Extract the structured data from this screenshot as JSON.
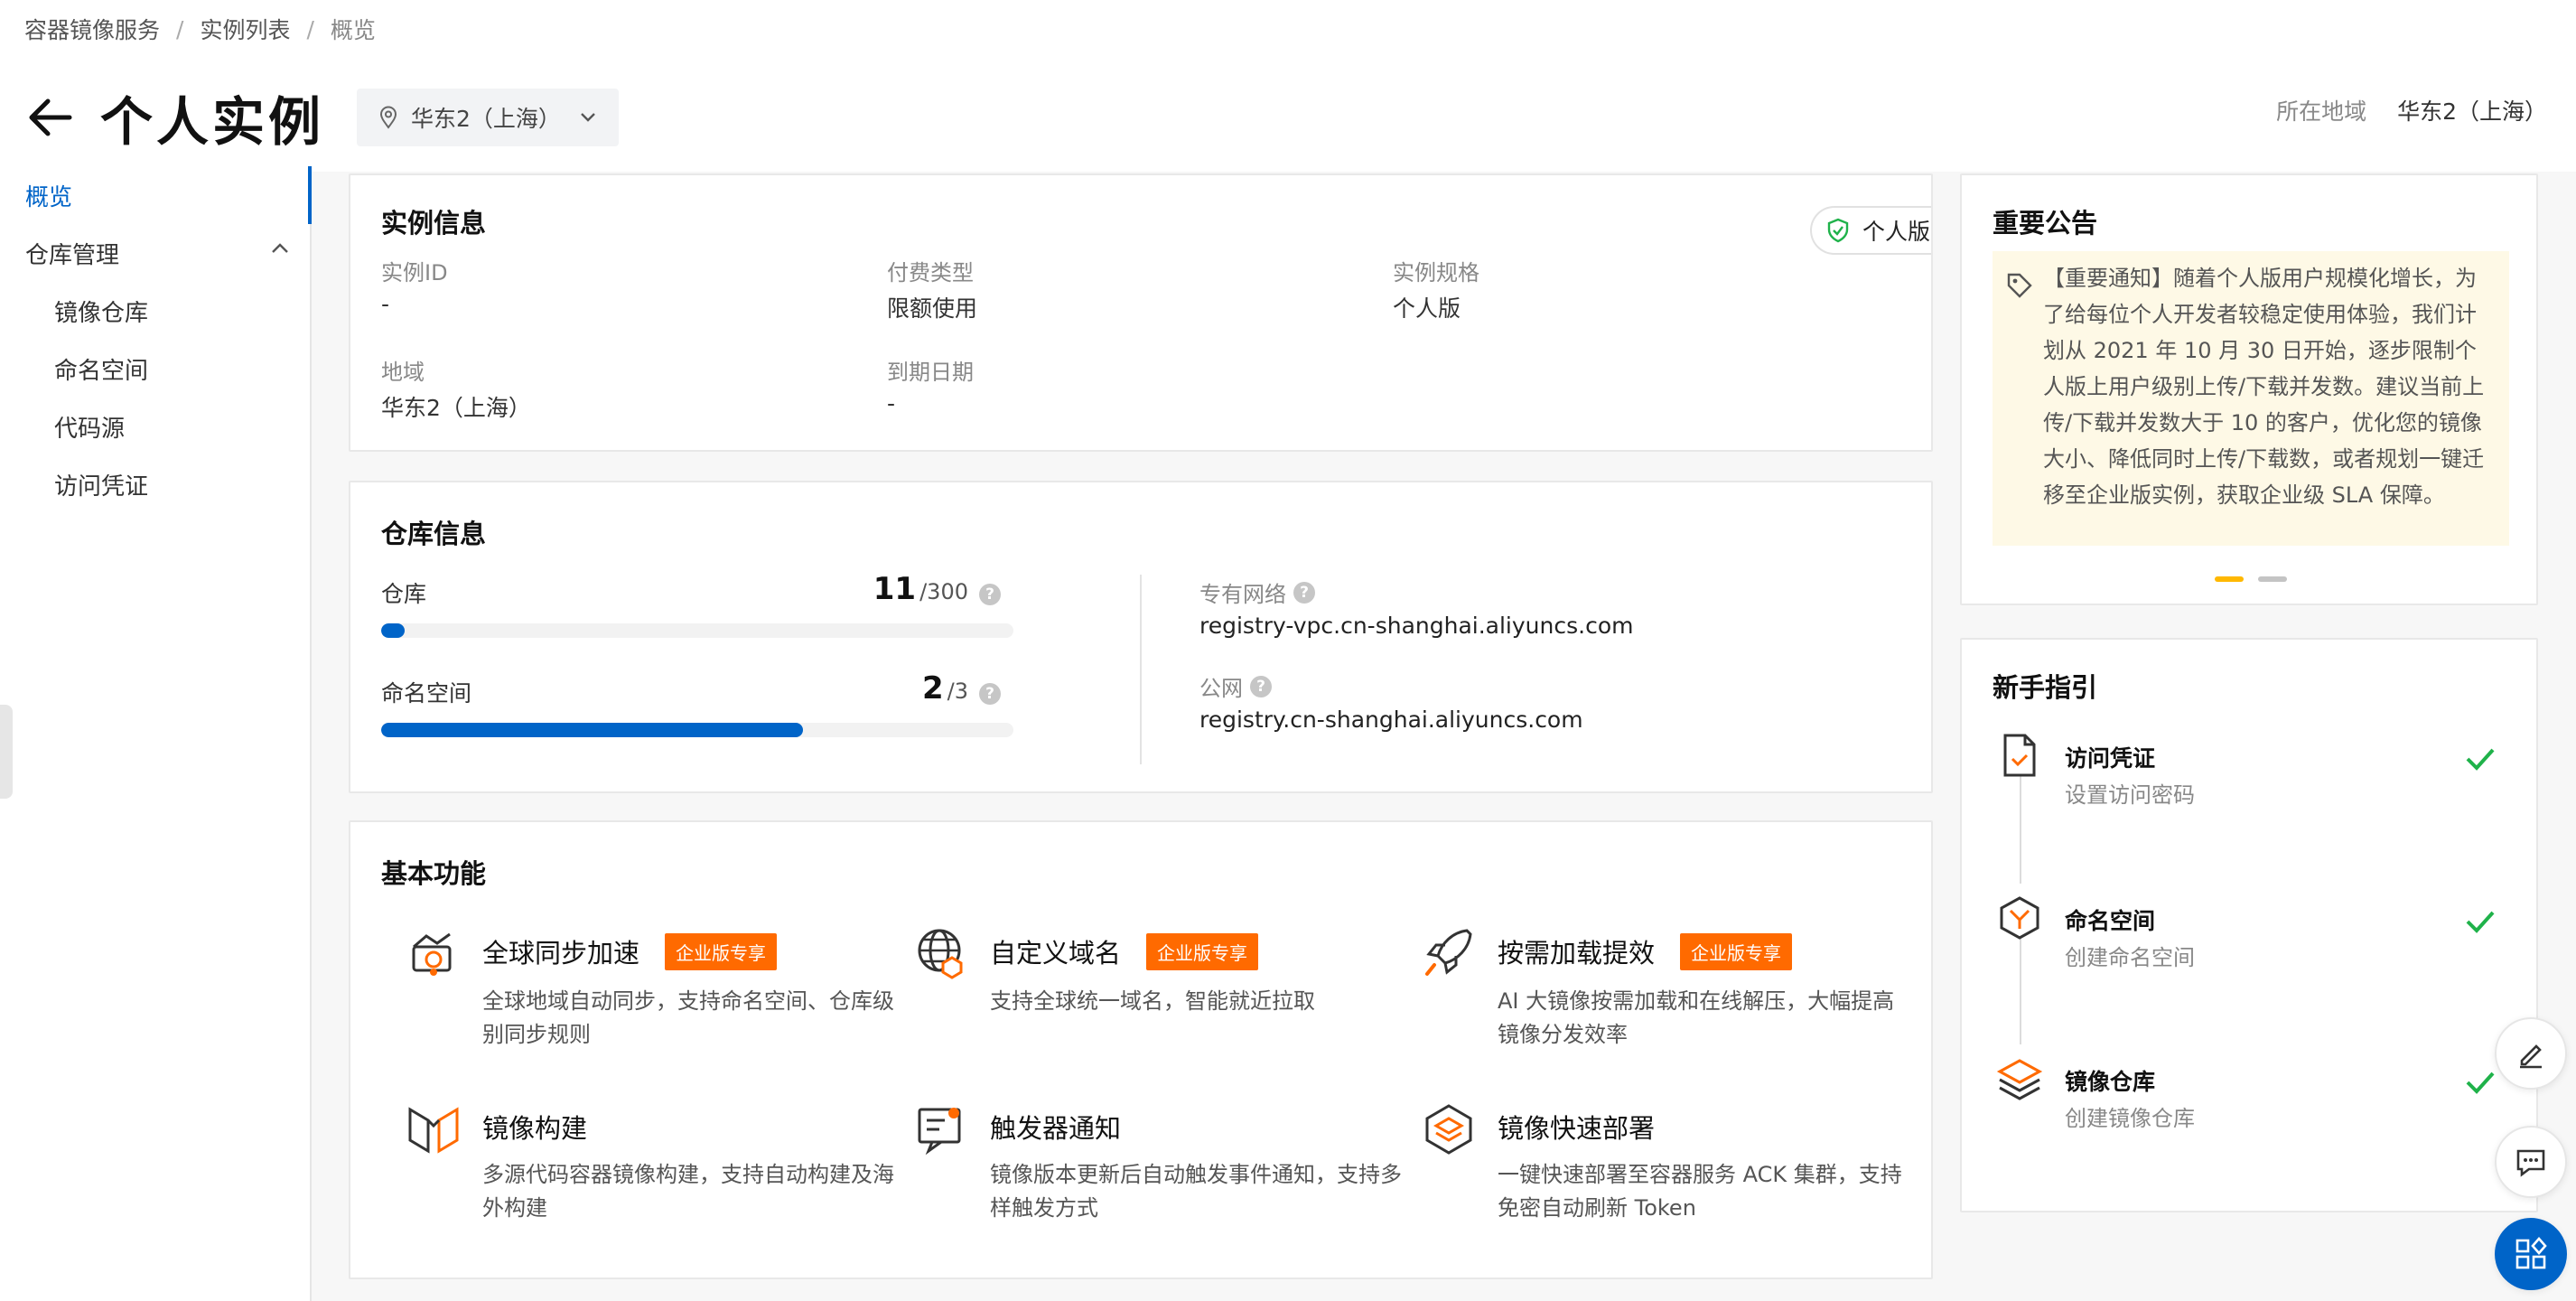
{
  "breadcrumb": [
    "容器镜像服务",
    "实例列表",
    "概览"
  ],
  "header": {
    "title": "个人实例",
    "region_select": "华东2（上海）",
    "region_label": "所在地域",
    "region_value": "华东2（上海）"
  },
  "sidebar": {
    "items": [
      {
        "label": "概览",
        "active": true
      },
      {
        "label": "仓库管理"
      },
      {
        "label": "镜像仓库"
      },
      {
        "label": "命名空间"
      },
      {
        "label": "代码源"
      },
      {
        "label": "访问凭证"
      }
    ]
  },
  "instance": {
    "title": "实例信息",
    "badge": "个人版",
    "fields": [
      {
        "label": "实例ID",
        "value": "-"
      },
      {
        "label": "付费类型",
        "value": "限额使用"
      },
      {
        "label": "实例规格",
        "value": "个人版"
      },
      {
        "label": "地域",
        "value": "华东2（上海）"
      },
      {
        "label": "到期日期",
        "value": "-"
      }
    ]
  },
  "repo": {
    "title": "仓库信息",
    "meters": [
      {
        "label": "仓库",
        "used": "11",
        "total": "/300",
        "fraction": 0.0367
      },
      {
        "label": "命名空间",
        "used": "2",
        "total": "/3",
        "fraction": 0.6667
      }
    ],
    "networks": [
      {
        "label": "专有网络",
        "value": "registry-vpc.cn-shanghai.aliyuncs.com"
      },
      {
        "label": "公网",
        "value": "registry.cn-shanghai.aliyuncs.com"
      }
    ]
  },
  "features": {
    "title": "基本功能",
    "enterprise_tag": "企业版专享",
    "items": [
      {
        "name": "全球同步加速",
        "desc": "全球地域自动同步，支持命名空间、仓库级别同步规则",
        "icon": "global-sync-icon",
        "enterprise": true
      },
      {
        "name": "自定义域名",
        "desc": "支持全球统一域名，智能就近拉取",
        "icon": "globe-icon",
        "enterprise": true
      },
      {
        "name": "按需加载提效",
        "desc": "AI 大镜像按需加载和在线解压，大幅提高镜像分发效率",
        "icon": "rocket-icon",
        "enterprise": true
      },
      {
        "name": "镜像构建",
        "desc": "多源代码容器镜像构建，支持自动构建及海外构建",
        "icon": "build-icon",
        "enterprise": false
      },
      {
        "name": "触发器通知",
        "desc": "镜像版本更新后自动触发事件通知，支持多样触发方式",
        "icon": "trigger-icon",
        "enterprise": false
      },
      {
        "name": "镜像快速部署",
        "desc": "一键快速部署至容器服务 ACK 集群，支持免密自动刷新 Token",
        "icon": "deploy-icon",
        "enterprise": false
      }
    ]
  },
  "notice": {
    "title": "重要公告",
    "text": "【重要通知】随着个人版用户规模化增长，为了给每位个人开发者较稳定使用体验，我们计划从 2021 年 10 月 30 日开始，逐步限制个人版上用户级别上传/下载并发数。建议当前上传/下载并发数大于 10 的客户，优化您的镜像大小、降低同时上传/下载数，或者规划一键迁移至企业版实例，获取企业级 SLA 保障。"
  },
  "guide": {
    "title": "新手指引",
    "steps": [
      {
        "name": "访问凭证",
        "sub": "设置访问密码",
        "done": true
      },
      {
        "name": "命名空间",
        "sub": "创建命名空间",
        "done": true
      },
      {
        "name": "镜像仓库",
        "sub": "创建镜像仓库",
        "done": true
      }
    ]
  },
  "colors": {
    "primary": "#0064c8",
    "enterprise": "#ff6a00",
    "success": "#1fb24a",
    "notice_bg": "#fef9e6"
  }
}
